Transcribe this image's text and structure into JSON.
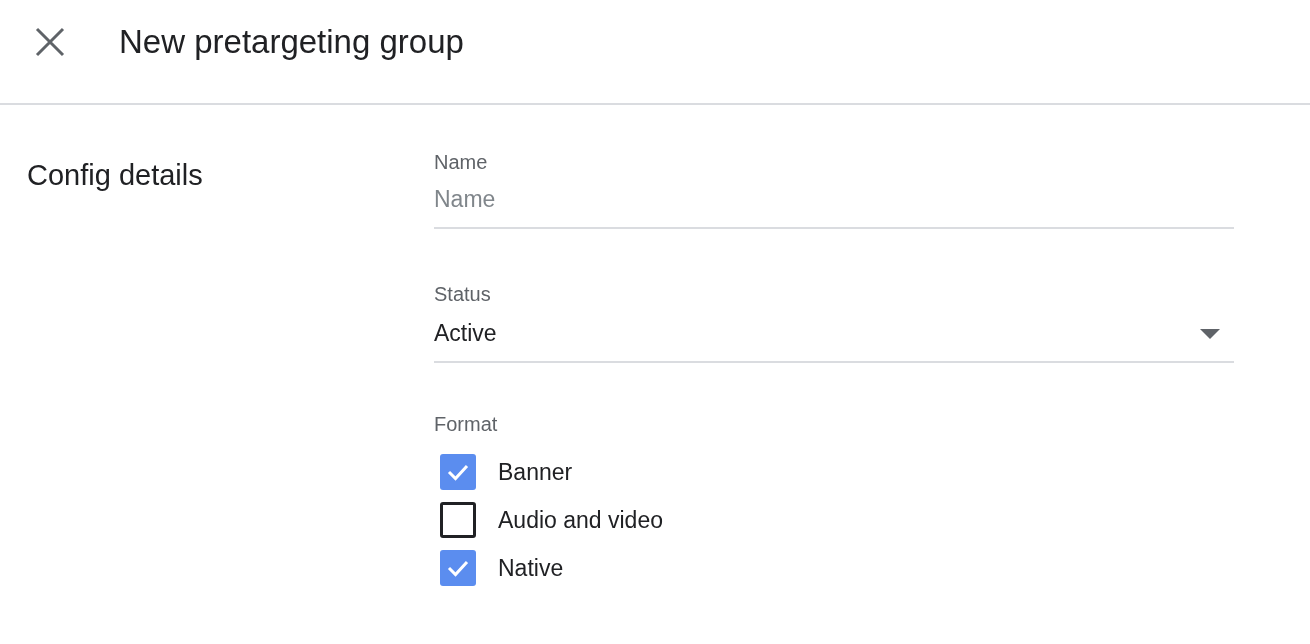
{
  "header": {
    "title": "New pretargeting group"
  },
  "section": {
    "title": "Config details"
  },
  "name_field": {
    "label": "Name",
    "placeholder": "Name"
  },
  "status_field": {
    "label": "Status",
    "value": "Active"
  },
  "format": {
    "label": "Format",
    "options": [
      {
        "label": "Banner",
        "checked": true
      },
      {
        "label": "Audio and video",
        "checked": false
      },
      {
        "label": "Native",
        "checked": true
      }
    ]
  }
}
